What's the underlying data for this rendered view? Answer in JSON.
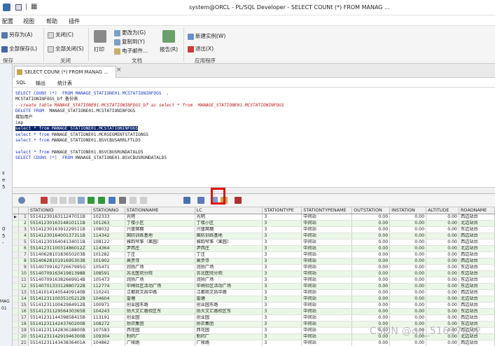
{
  "window": {
    "title": "system@ORCL - PL/SQL Developer - SELECT COUNt (*)  FROM MANAG ...",
    "menu": [
      "配置",
      "视图",
      "帮助",
      "插件"
    ]
  },
  "ribbon": {
    "buttons": {
      "save_as": "另存为(A)",
      "close": "关闭(C)",
      "save_all": "全部保存(L)",
      "close_all": "全部关闭(S)",
      "print": "打印",
      "change_to": "更改为(G)",
      "copy_to": "复制到(Y)",
      "email": "电子邮件...",
      "report": "报告(R)",
      "new_instance": "新建实例(W)",
      "exit": "退出(X)"
    },
    "groups": {
      "save": "保存",
      "close": "关闭",
      "doc": "文档",
      "app": "应用程序"
    }
  },
  "doc_tab": {
    "label": "SELECT COUNt (*)  FROM MANAG ..."
  },
  "sub_tabs": [
    "SQL",
    "输出",
    "统计表"
  ],
  "editor": {
    "lines": [
      [
        {
          "t": "SELECT COUNt (*)  FROM MANAGE_STATIONE01.MCSTATIONINFOGS  、",
          "c": "kw"
        }
      ],
      [
        {
          "t": "MCSTATIONINFOGS_bf 备份表",
          "c": ""
        }
      ],
      [
        {
          "t": "--create table MANAGE_STATIONE01.MCSTATIONINFOGS_bf as select * from  MANAGE_STATIONE01.MCSTATIONINFOGS",
          "c": "cm"
        }
      ],
      [
        {
          "t": "DELETE FROM  ",
          "c": "kw"
        },
        {
          "t": "MANAGE_STATIONE01.MCSTATIONINFOGS",
          "c": ""
        }
      ],
      [
        {
          "t": "增加用户",
          "c": ""
        }
      ],
      [
        {
          "t": "imp",
          "c": ""
        }
      ],
      [
        {
          "t": "select * from MANAGE_STATIONE01.MCSTATIONINFOGS",
          "c": "hl"
        }
      ],
      [
        {
          "t": "select * from ",
          "c": "kw"
        },
        {
          "t": "MANAGE_STATIONE01.MCRSEGMENTSTATIONGS",
          "c": ""
        }
      ],
      [
        {
          "t": "select * from ",
          "c": "kw"
        },
        {
          "t": "MANAGE_STATIONE01.BSVCBUSARRLFTLD5",
          "c": ""
        }
      ],
      [
        {
          "t": "",
          "c": ""
        }
      ],
      [
        {
          "t": "select * from ",
          "c": "kw"
        },
        {
          "t": "MANAGE_STATIONE01.BSVCBUSRUNDATALD5",
          "c": ""
        }
      ],
      [
        {
          "t": "SELECT COUNt (*)  FROM ",
          "c": "kw"
        },
        {
          "t": "MANAGE_STATIONE01.BSVCBUSRUNDATALD5",
          "c": ""
        }
      ]
    ]
  },
  "left_labels": [
    "s",
    "e",
    "5",
    "0",
    "5",
    "-",
    "MAG",
    "01"
  ],
  "grid": {
    "columns": [
      "",
      "STATIONID",
      "STATIONNO",
      "STATIONNAME",
      "LC",
      "STATIONTYPE",
      "STATIONTYPENAME",
      "OUTSTATION",
      "INSTATION",
      "ALTITUDE",
      "ROADNAME"
    ],
    "rows": [
      [
        "1",
        "5514123016311247011B",
        "102333",
        "光明",
        "光明",
        "3",
        "中间站",
        "0.00",
        "0.00",
        "0.00",
        "西边站台"
      ],
      [
        "2",
        "5514123016314810111B",
        "101263",
        "丁楼小区",
        "丁楼小区",
        "3",
        "中间站",
        "0.00",
        "0.00",
        "0.00",
        "北边站台"
      ],
      [
        "3",
        "5514123016391229511B",
        "108032",
        "兴盛窝棚",
        "兴盛窝棚",
        "3",
        "中间站",
        "0.00",
        "0.00",
        "0.00",
        "东边站台"
      ],
      [
        "4",
        "5514123016400137311B",
        "114342",
        "国防训练基地",
        "国防训练基地",
        "3",
        "中间站",
        "0.00",
        "0.00",
        "0.00",
        "西边站台"
      ],
      [
        "5",
        "5514123016404134011B",
        "108122",
        "雅韵琴筝（果园）",
        "雅韵琴筝（果园）",
        "3",
        "中间站",
        "0.00",
        "0.00",
        "0.00",
        "西边站台"
      ],
      [
        "6",
        "5514123110031486012Z",
        "114364",
        "尹西庄",
        "尹西庄",
        "3",
        "中间站",
        "0.00",
        "0.00",
        "0.00",
        "北边站台"
      ],
      [
        "7",
        "5514062810183650203B",
        "101282",
        "丁庄",
        "丁庄",
        "3",
        "中间站",
        "0.00",
        "0.00",
        "0.00",
        "西边站台"
      ],
      [
        "8",
        "5514062810191695303B",
        "101902",
        "高贾寺",
        "高贾寺",
        "3",
        "中间站",
        "0.00",
        "0.00",
        "0.00",
        "西边站台"
      ],
      [
        "9",
        "5514070916272667995G",
        "105471",
        "润扬广场",
        "润扬广场",
        "3",
        "中间站",
        "0.00",
        "0.00",
        "0.00",
        "东边站台"
      ],
      [
        "10",
        "5514070916341981398B",
        "108591",
        "苏北医院分院",
        "苏北医院分院",
        "3",
        "中间站",
        "0.00",
        "0.00",
        "0.00",
        "东边站台"
      ],
      [
        "11",
        "5514070916382669914B",
        "105473",
        "润扬广场",
        "润扬广场",
        "3",
        "中间站",
        "0.00",
        "0.00",
        "0.00",
        "东边站台"
      ],
      [
        "12",
        "5514070133312880722B",
        "112774",
        "中闸社区活动广场",
        "中闸社区活动广场",
        "3",
        "中间站",
        "0.00",
        "0.00",
        "0.00",
        "东边站台"
      ],
      [
        "13",
        "5514101414054409140B",
        "110241",
        "江都商文昌中路",
        "江都商文昌中路",
        "3",
        "中间站",
        "0.00",
        "0.00",
        "0.00",
        "西边站台"
      ],
      [
        "14",
        "5514123110035105212B",
        "104604",
        "雷塘",
        "雷塘",
        "3",
        "中间站",
        "0.00",
        "0.00",
        "0.00",
        "北边站台"
      ],
      [
        "15",
        "5514123110042984912B",
        "100971",
        "创业园东路",
        "创业园东路",
        "3",
        "中间站",
        "0.00",
        "0.00",
        "0.00",
        "西边站台"
      ],
      [
        "16",
        "5514123112956430365B",
        "104243",
        "扬大文汇路校区东",
        "扬大文汇路校区东",
        "3",
        "中间站",
        "0.00",
        "0.00",
        "0.00",
        "东边站台"
      ],
      [
        "17",
        "5514123114439858415B",
        "113191",
        "创业园",
        "创业园",
        "3",
        "中间站",
        "0.00",
        "0.00",
        "0.00",
        "西边站台"
      ],
      [
        "18",
        "5514123114243760200B",
        "108272",
        "扬农集团",
        "扬农集团",
        "3",
        "中间站",
        "0.00",
        "0.00",
        "0.00",
        "东边站台"
      ],
      [
        "19",
        "5514123114283618800B",
        "107583",
        "西花园",
        "西花园",
        "3",
        "中间站",
        "0.00",
        "0.00",
        "0.00",
        "西边站台"
      ],
      [
        "20",
        "5514123114291946300B",
        "109304",
        "制药厂",
        "制药厂",
        "3",
        "中间站",
        "0.00",
        "0.00",
        "0.00",
        "北边站台"
      ],
      [
        "21",
        "5514123114343836401A",
        "104862",
        "广陵路",
        "广陵路",
        "3",
        "中间站",
        "0.00",
        "0.00",
        "0.00",
        "西边站台"
      ]
    ]
  },
  "watermark": "CSDN @qq_51637082",
  "colors": {
    "highlight_box": "#e01010",
    "row_alt": "#ebf7e7",
    "selection": "#0a246a",
    "keyword": "#1a35c8",
    "comment": "#c01818"
  }
}
